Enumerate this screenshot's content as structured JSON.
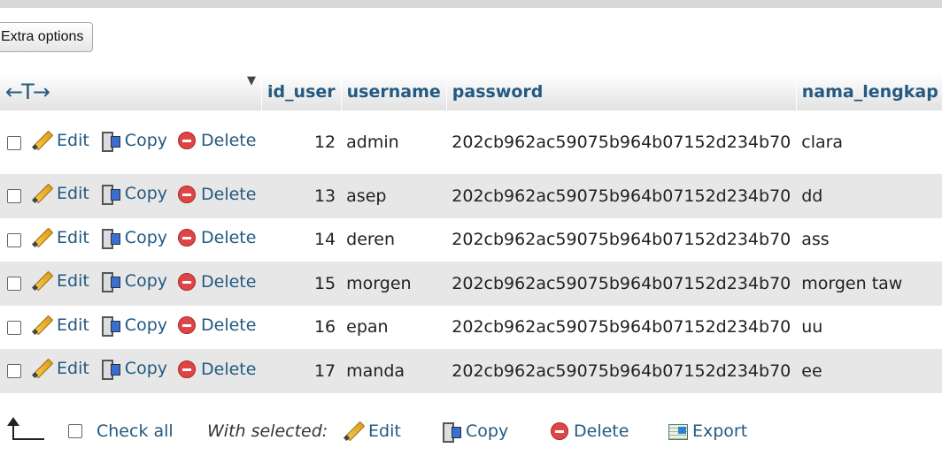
{
  "toolbar": {
    "extra_options_label": "Extra options"
  },
  "table": {
    "header": {
      "arrows": "←T→",
      "columns": [
        "id_user",
        "username",
        "password",
        "nama_lengkap"
      ]
    },
    "actions": {
      "edit": "Edit",
      "copy": "Copy",
      "delete": "Delete"
    },
    "rows": [
      {
        "id_user": "12",
        "username": "admin",
        "password": "202cb962ac59075b964b07152d234b70",
        "nama_lengkap": "clara"
      },
      {
        "id_user": "13",
        "username": "asep",
        "password": "202cb962ac59075b964b07152d234b70",
        "nama_lengkap": "dd"
      },
      {
        "id_user": "14",
        "username": "deren",
        "password": "202cb962ac59075b964b07152d234b70",
        "nama_lengkap": "ass"
      },
      {
        "id_user": "15",
        "username": "morgen",
        "password": "202cb962ac59075b964b07152d234b70",
        "nama_lengkap": "morgen taw"
      },
      {
        "id_user": "16",
        "username": "epan",
        "password": "202cb962ac59075b964b07152d234b70",
        "nama_lengkap": "uu"
      },
      {
        "id_user": "17",
        "username": "manda",
        "password": "202cb962ac59075b964b07152d234b70",
        "nama_lengkap": "ee"
      }
    ]
  },
  "footer": {
    "check_all": "Check all",
    "with_selected": "With selected:",
    "edit": "Edit",
    "copy": "Copy",
    "delete": "Delete",
    "export": "Export"
  },
  "colors": {
    "link": "#235a81",
    "row_alt": "#e7e7e7",
    "delete": "#e04545"
  }
}
